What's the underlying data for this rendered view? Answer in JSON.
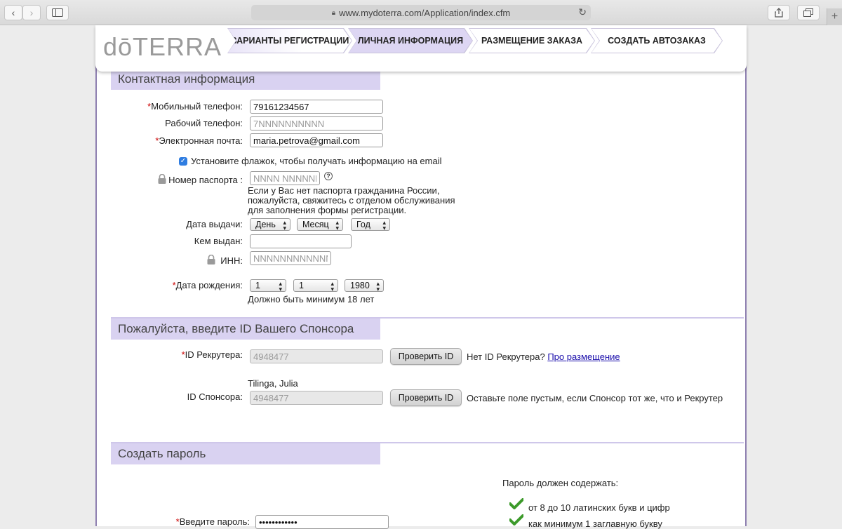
{
  "browser": {
    "url": "www.mydoterra.com/Application/index.cfm"
  },
  "brand": {
    "logo_text": "dōTERRA"
  },
  "steps": [
    {
      "label": "ВАРИАНТЫ РЕГИСТРАЦИИ"
    },
    {
      "label": "ЛИЧНАЯ ИНФОРМАЦИЯ",
      "active": true
    },
    {
      "label": "РАЗМЕЩЕНИЕ ЗАКАЗА"
    },
    {
      "label": "СОЗДАТЬ АВТОЗАКАЗ"
    }
  ],
  "contact": {
    "title": "Контактная информация",
    "mobile_label": "Мобильный телефон:",
    "mobile_value": "79161234567",
    "work_label": "Рабочий телефон:",
    "work_placeholder": "7NNNNNNNNNN",
    "email_label": "Электронная почта:",
    "email_value": "maria.petrova@gmail.com",
    "email_opt_in": "Установите флажок, чтобы получать информацию на email",
    "passport_label": "Номер паспорта :",
    "passport_placeholder": "NNNN NNNNNN",
    "passport_help_1": "Если у Вас нет паспорта гражданина России,",
    "passport_help_2": "пожалуйста, свяжитесь с отделом обслуживания",
    "passport_help_3": "для заполнения формы регистрации.",
    "issue_date_label": "Дата выдачи:",
    "issue_day": "День",
    "issue_month": "Месяц",
    "issue_year": "Год",
    "issued_by_label": "Кем выдан:",
    "inn_label": "ИНН:",
    "inn_placeholder": "NNNNNNNNNNNN",
    "dob_label": "Дата рождения:",
    "dob_day": "1",
    "dob_month": "1",
    "dob_year": "1980",
    "dob_note": "Должно быть минимум 18 лет"
  },
  "sponsor": {
    "title": "Пожалуйста, введите ID Вашего Спонсора",
    "recruiter_label": "ID Рекрутера:",
    "recruiter_value": "4948477",
    "check_button": "Проверить ID",
    "no_id_text": "Нет ID Рекрутера?",
    "about_link": "Про размещение",
    "sponsor_name": "Tilinga, Julia",
    "sponsor_label": "ID Спонсора:",
    "sponsor_value": "4948477",
    "sponsor_hint": "Оставьте поле пустым, если Спонсор тот же, что и Рекрутер"
  },
  "password": {
    "title": "Создать пароль",
    "rules_title": "Пароль должен содержать:",
    "rule_1": "от 8 до 10 латинских букв и цифр",
    "rule_2": "как минимум 1 заглавную букву",
    "enter_label": "Введите пароль:",
    "enter_value": "••••••••••••"
  },
  "colors": {
    "accent": "#d9d2f1",
    "frame": "#8e7fb0",
    "required": "#cc0000",
    "link": "#1a0dab",
    "check_green": "#3c9a2a"
  }
}
